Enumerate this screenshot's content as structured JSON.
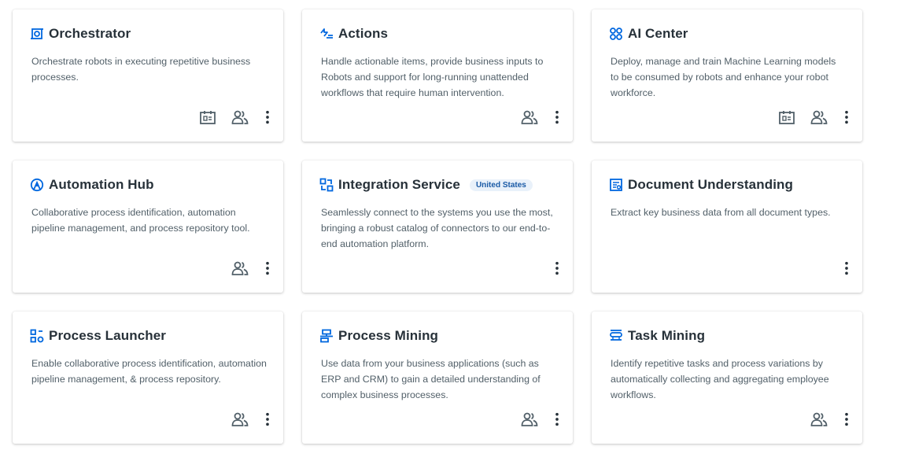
{
  "colors": {
    "accent": "#0067df",
    "icon_gray": "#526069",
    "badge_bg": "#e9f1fa",
    "badge_text": "#1a5aa6"
  },
  "cards": [
    {
      "title": "Orchestrator",
      "icon": "orchestrator-icon",
      "badge": "",
      "description": "Orchestrate robots in executing repetitive business processes.",
      "actions": [
        "license-icon",
        "users-icon",
        "more-icon"
      ]
    },
    {
      "title": "Actions",
      "icon": "actions-icon",
      "badge": "",
      "description": "Handle actionable items, provide business inputs to Robots and support for long-running unattended workflows that require human intervention.",
      "actions": [
        "users-icon",
        "more-icon"
      ]
    },
    {
      "title": "AI Center",
      "icon": "ai-center-icon",
      "badge": "",
      "description": "Deploy, manage and train Machine Learning models to be consumed by robots and enhance your robot workforce.",
      "actions": [
        "license-icon",
        "users-icon",
        "more-icon"
      ]
    },
    {
      "title": "Automation Hub",
      "icon": "automation-hub-icon",
      "badge": "",
      "description": "Collaborative process identification, automation pipeline management, and process repository tool.",
      "actions": [
        "users-icon",
        "more-icon"
      ]
    },
    {
      "title": "Integration Service",
      "icon": "integration-service-icon",
      "badge": "United States",
      "description": "Seamlessly connect to the systems you use the most, bringing a robust catalog of connectors to our end-to-end automation platform.",
      "actions": [
        "more-icon"
      ]
    },
    {
      "title": "Document Understanding",
      "icon": "document-understanding-icon",
      "badge": "",
      "description": "Extract key business data from all document types.",
      "actions": [
        "more-icon"
      ]
    },
    {
      "title": "Process Launcher",
      "icon": "process-launcher-icon",
      "badge": "",
      "description": "Enable collaborative process identification, automation pipeline management, & process repository.",
      "actions": [
        "users-icon",
        "more-icon"
      ]
    },
    {
      "title": "Process Mining",
      "icon": "process-mining-icon",
      "badge": "",
      "description": "Use data from your business applications (such as ERP and CRM) to gain a detailed understanding of complex business processes.",
      "actions": [
        "users-icon",
        "more-icon"
      ]
    },
    {
      "title": "Task Mining",
      "icon": "task-mining-icon",
      "badge": "",
      "description": "Identify repetitive tasks and process variations by automatically collecting and aggregating employee workflows.",
      "actions": [
        "users-icon",
        "more-icon"
      ]
    }
  ]
}
